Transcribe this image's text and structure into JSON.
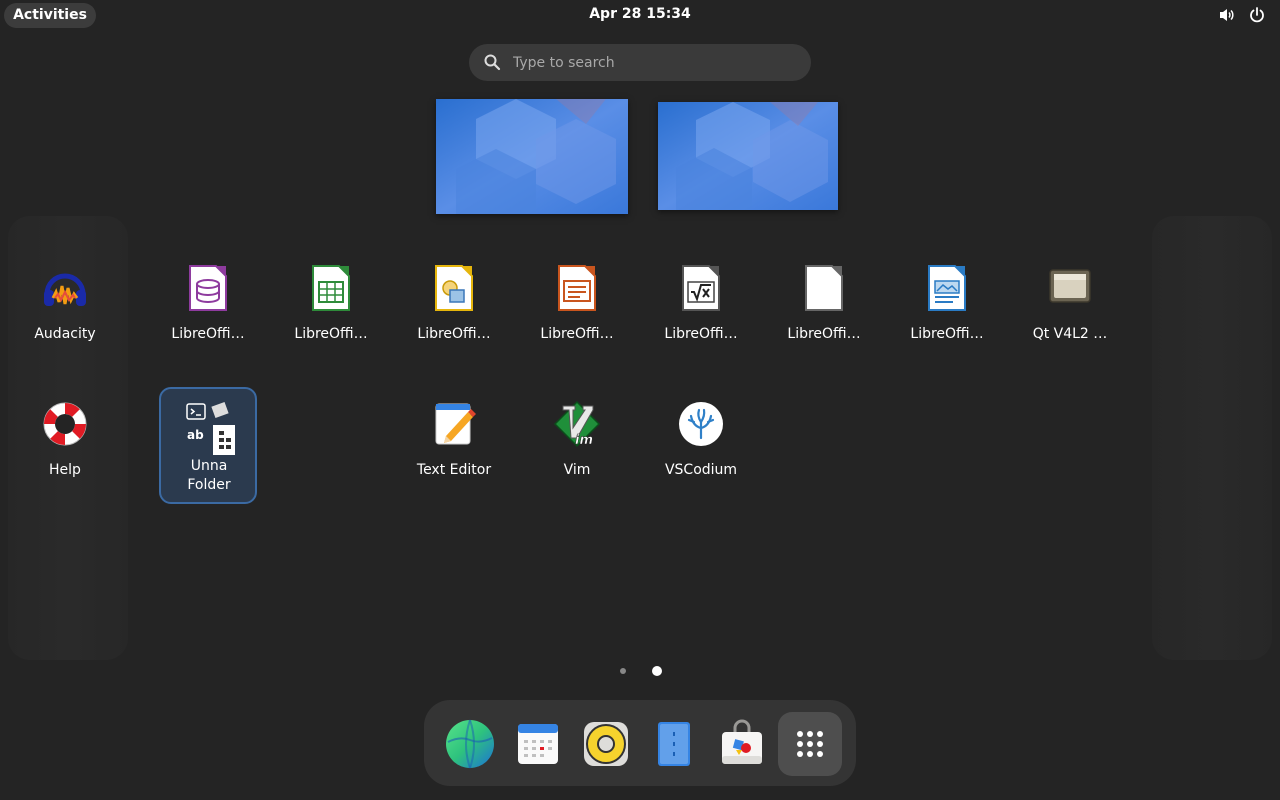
{
  "topbar": {
    "activities_label": "Activities",
    "clock": "Apr 28  15:34",
    "icons": [
      "volume-icon",
      "power-icon"
    ]
  },
  "search": {
    "placeholder": "Type to search"
  },
  "workspaces": [
    "workspace-1-thumbnail",
    "workspace-2-thumbnail"
  ],
  "app_grid": {
    "row1": [
      {
        "label": "Audacity",
        "icon": "audacity-icon"
      },
      {
        "label": "LibreOffi…",
        "icon": "libreoffice-base-icon"
      },
      {
        "label": "LibreOffi…",
        "icon": "libreoffice-calc-icon"
      },
      {
        "label": "LibreOffi…",
        "icon": "libreoffice-draw-icon"
      },
      {
        "label": "LibreOffi…",
        "icon": "libreoffice-impress-icon"
      },
      {
        "label": "LibreOffi…",
        "icon": "libreoffice-math-icon"
      },
      {
        "label": "LibreOffi…",
        "icon": "libreoffice-startcenter-icon"
      },
      {
        "label": "LibreOffi…",
        "icon": "libreoffice-writer-icon"
      },
      {
        "label": "Qt V4L2 …",
        "icon": "qt-v4l2-icon"
      }
    ],
    "row2": [
      {
        "label": "Help",
        "icon": "help-lifebuoy-icon"
      },
      {
        "label": "Text Editor",
        "icon": "text-editor-icon"
      },
      {
        "label": "Vim",
        "icon": "vim-icon"
      },
      {
        "label": "VSCodium",
        "icon": "vscodium-icon"
      }
    ],
    "folder": {
      "label_line1": "Unna",
      "label_line2": "Folder",
      "icon": "folder-icon"
    }
  },
  "pagination": {
    "pages": 2,
    "current": 2
  },
  "dash": {
    "items": [
      "web-browser-icon",
      "calendar-icon",
      "rhythmbox-icon",
      "file-manager-icon",
      "software-store-icon"
    ],
    "show_apps": "show-apps-icon"
  },
  "colors": {
    "background": "#242424",
    "folder_border": "#3b6aa3",
    "accent_blue": "#3584e4"
  }
}
